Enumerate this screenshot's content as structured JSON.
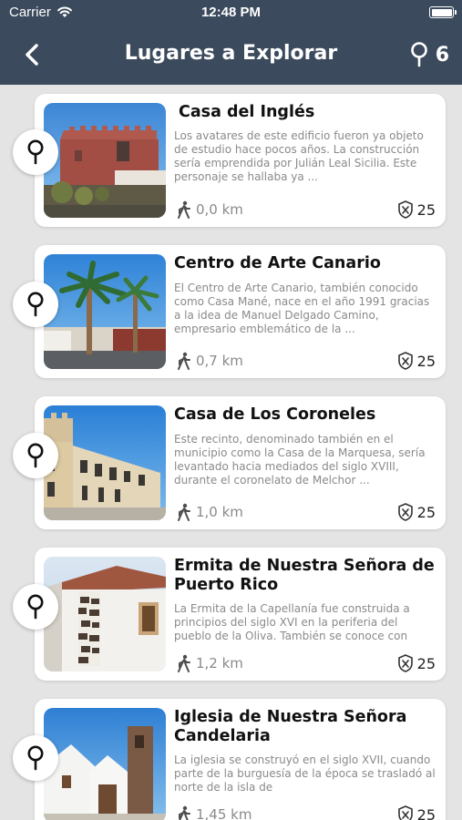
{
  "status": {
    "carrier": "Carrier",
    "time": "12:48 PM"
  },
  "nav": {
    "title": "Lugares a Explorar",
    "count": "6",
    "back_icon": "chevron-left-icon",
    "pin_icon": "map-pin-icon"
  },
  "colors": {
    "header": "#3b4a5c",
    "background": "#e4e4e4",
    "card": "#ffffff",
    "muted": "#8a8a8a"
  },
  "places": [
    {
      "title": "Casa del Inglés",
      "description": "Los avatares de este edificio fueron ya objeto de estudio hace pocos años. La construcción sería emprendida por Julián Leal Sicilia. Este personaje se hallaba ya ...",
      "distance": "0,0 km",
      "points": "25"
    },
    {
      "title": "Centro de Arte Canario",
      "description": "El Centro de Arte Canario, también conocido como Casa Mané, nace en el año 1991 gracias a la idea de Manuel Delgado Camino, empresario emblemático de la ...",
      "distance": "0,7 km",
      "points": "25"
    },
    {
      "title": "Casa de Los Coroneles",
      "description": "Este recinto, denominado también en el municipio como la Casa de la Marquesa, sería levantado hacia mediados del siglo XVIII, durante el coronelato de Melchor ...",
      "distance": "1,0 km",
      "points": "25"
    },
    {
      "title": "Ermita de Nuestra Señora de Puerto Rico",
      "description": "La Ermita de la Capellanía fue construida a principios del siglo XVI  en la periferia del pueblo de la Oliva. También se conoce con",
      "distance": "1,2 km",
      "points": "25"
    },
    {
      "title": "Iglesia de Nuestra Señora Candelaria",
      "description": "La iglesia se construyó en el siglo XVII, cuando parte de la burguesía de la época se trasladó al norte de la isla de",
      "distance": "1,45 km",
      "points": "25"
    }
  ]
}
